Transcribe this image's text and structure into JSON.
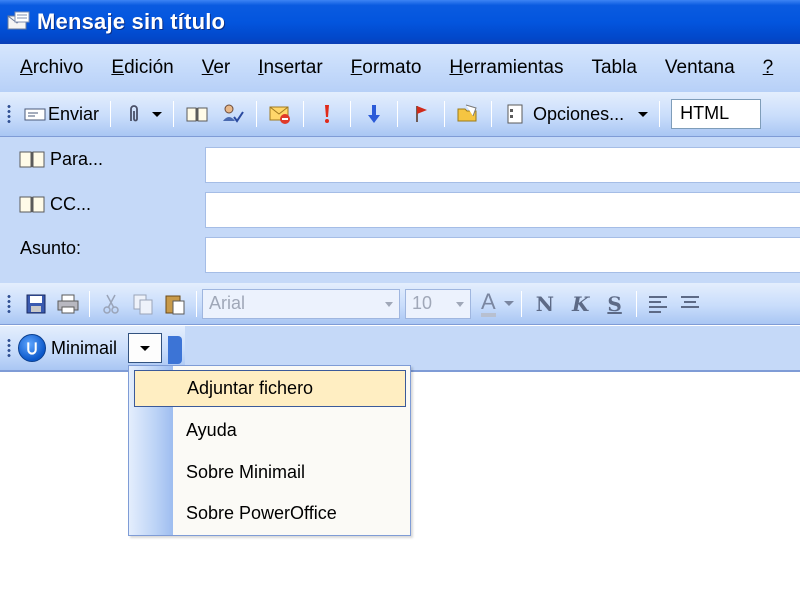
{
  "window": {
    "title": "Mensaje sin título"
  },
  "menubar": {
    "items": [
      {
        "label": "Archivo",
        "accel": "A",
        "rest": "rchivo"
      },
      {
        "label": "Edición",
        "accel": "E",
        "rest": "dición"
      },
      {
        "label": "Ver",
        "accel": "V",
        "rest": "er"
      },
      {
        "label": "Insertar",
        "accel": "I",
        "rest": "nsertar"
      },
      {
        "label": "Formato",
        "accel": "F",
        "rest": "ormato"
      },
      {
        "label": "Herramientas",
        "accel": "H",
        "rest": "erramientas"
      },
      {
        "label": "Tabla",
        "accel": "",
        "rest": "Tabla"
      },
      {
        "label": "Ventana",
        "accel": "",
        "rest": "Ventana"
      },
      {
        "label": "?",
        "accel": "?",
        "rest": ""
      }
    ]
  },
  "toolbar": {
    "send_label": "Enviar",
    "options_label": "Opciones...",
    "format_value": "HTML"
  },
  "header": {
    "to_label": "Para...",
    "cc_label": "CC...",
    "subject_label": "Asunto:",
    "to_value": "",
    "cc_value": "",
    "subject_value": ""
  },
  "format_toolbar": {
    "font_value": "Arial",
    "size_value": "10",
    "bold_label": "N",
    "italic_label": "K",
    "underline_label": "S",
    "font_color_label": "A"
  },
  "minimail": {
    "label": "Minimail",
    "menu": [
      {
        "label": "Adjuntar fichero",
        "selected": true
      },
      {
        "label": "Ayuda",
        "selected": false
      },
      {
        "label": "Sobre Minimail",
        "selected": false
      },
      {
        "label": "Sobre PowerOffice",
        "selected": false
      }
    ]
  },
  "colors": {
    "titlebar": "#0355de",
    "toolbar": "#c9ddfb",
    "highlight": "#ffeec2"
  }
}
